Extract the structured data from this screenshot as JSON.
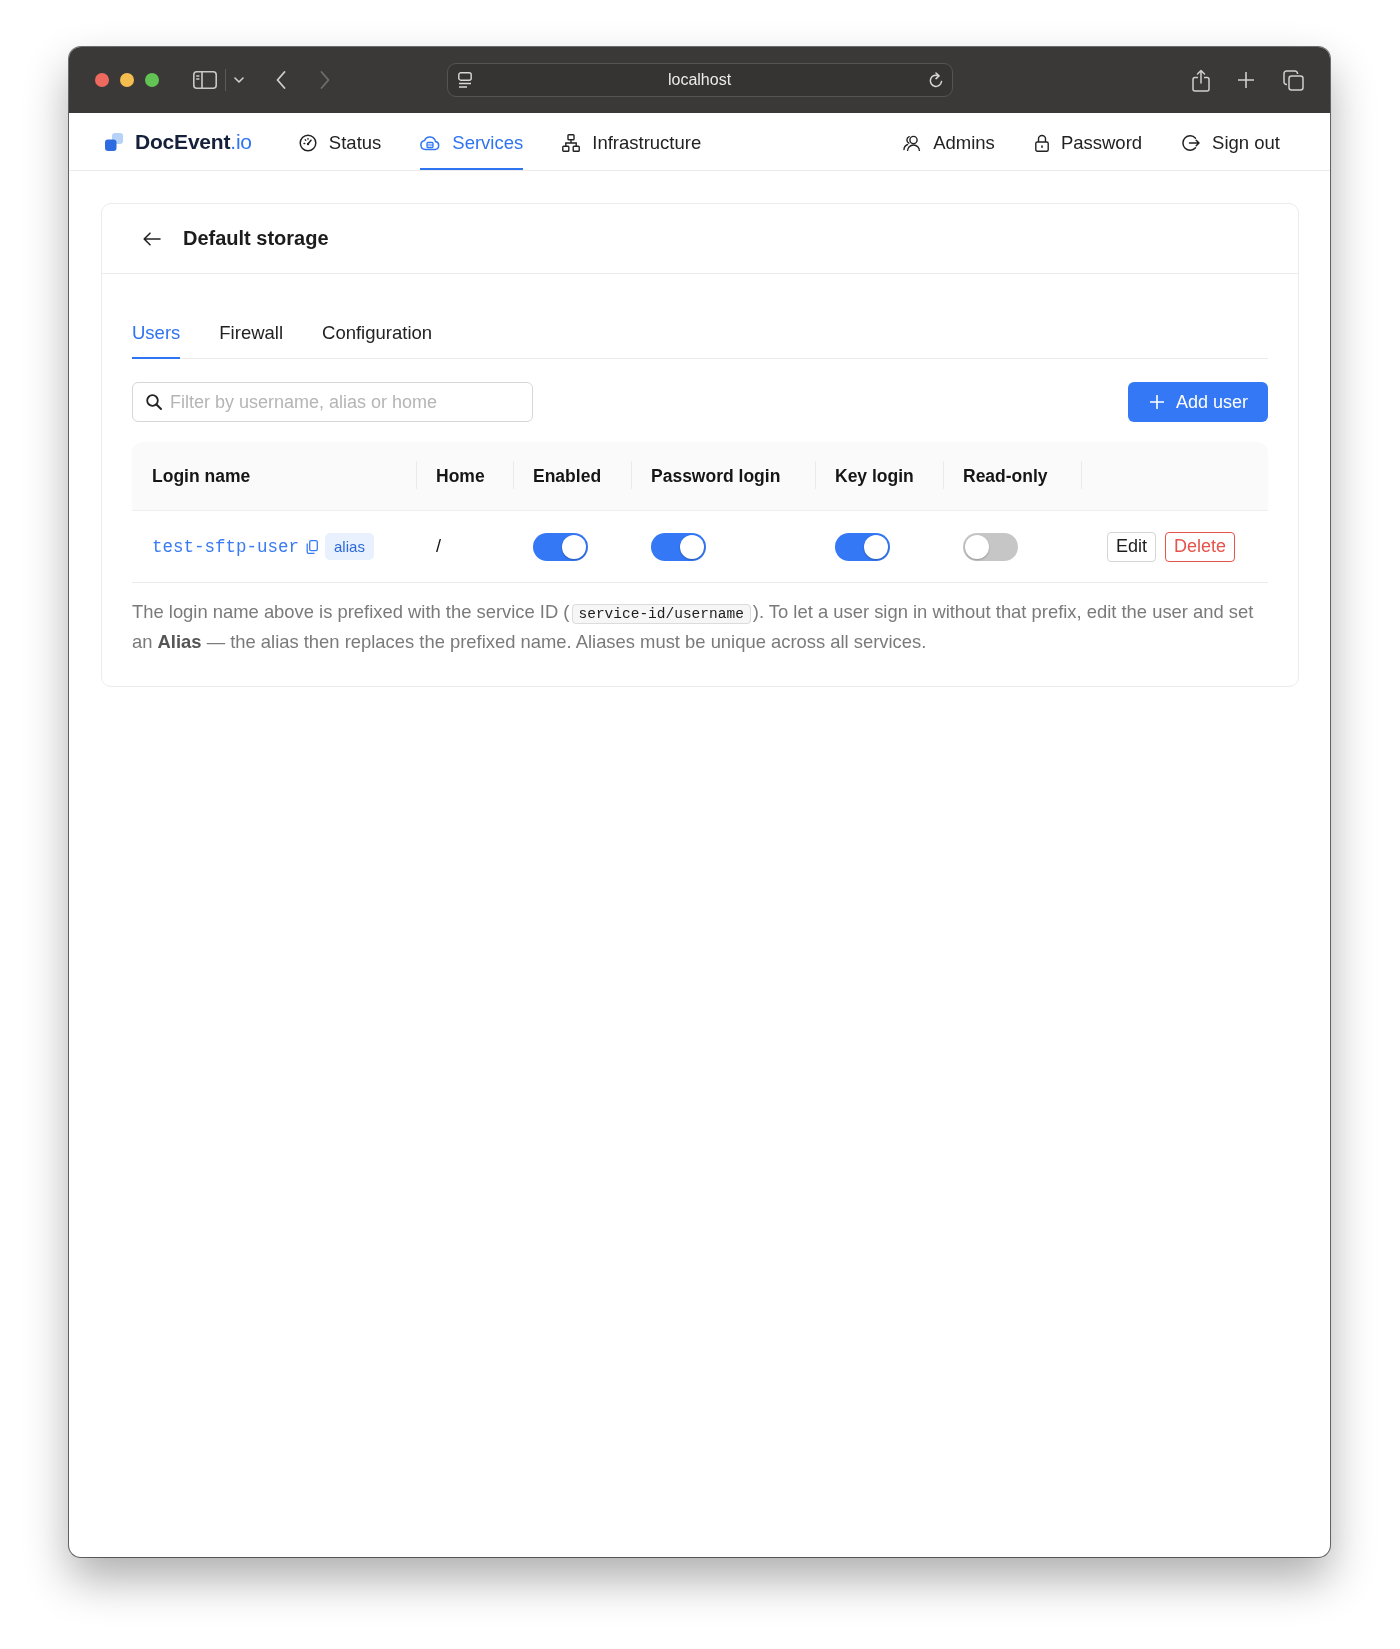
{
  "browser": {
    "url": "localhost",
    "back": {
      "disabled": false
    },
    "forward": {
      "disabled": true
    }
  },
  "nav": {
    "brand": {
      "name": "DocEvent",
      "suffix": ".io"
    },
    "items": [
      {
        "label": "Status",
        "selected": false
      },
      {
        "label": "Services",
        "selected": true
      },
      {
        "label": "Infrastructure",
        "selected": false
      }
    ],
    "account_items": [
      {
        "label": "Admins",
        "selected": false
      },
      {
        "label": "Password",
        "selected": false
      },
      {
        "label": "Sign out",
        "selected": false
      }
    ]
  },
  "page": {
    "title": "Default storage"
  },
  "tabs": [
    {
      "label": "Users",
      "selected": true
    },
    {
      "label": "Firewall",
      "selected": false
    },
    {
      "label": "Configuration",
      "selected": false
    }
  ],
  "search": {
    "placeholder": "Filter by username, alias or home"
  },
  "add_button": {
    "label": "Add user"
  },
  "table": {
    "columns": [
      "Login name",
      "Home",
      "Enabled",
      "Password login",
      "Key login",
      "Read-only"
    ],
    "rows": [
      {
        "login_name": "test-sftp-user",
        "badge": "alias",
        "home": "/",
        "enabled": true,
        "password_login": true,
        "key_login": true,
        "read_only": false,
        "actions": [
          {
            "label": "Edit",
            "kind": "edit"
          },
          {
            "label": "Delete",
            "kind": "delete"
          }
        ]
      }
    ]
  },
  "note": {
    "before": "The login name above is prefixed with the service ID (",
    "code": "service-id/username",
    "after": "). To let a user sign in without that prefix, edit the user and set an **Alias** — the alias then replaces the prefixed name. Aliases must be unique across all services."
  }
}
